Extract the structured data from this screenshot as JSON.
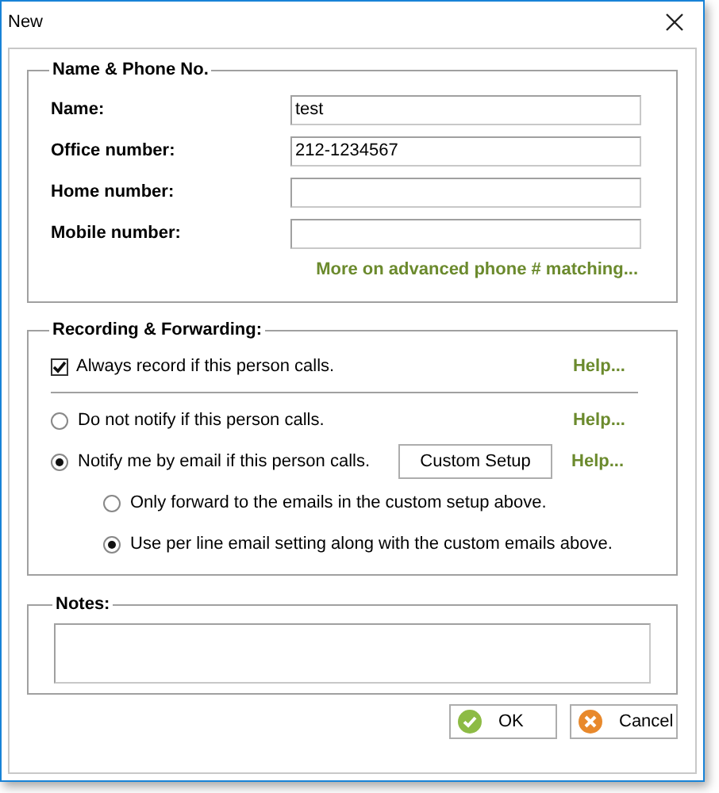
{
  "window": {
    "title": "New"
  },
  "name_phone": {
    "legend": "Name & Phone No.",
    "fields": [
      {
        "label": "Name:",
        "value": "test"
      },
      {
        "label": "Office number:",
        "value": "212-1234567"
      },
      {
        "label": "Home number:"
      },
      {
        "label": "Mobile number:"
      }
    ],
    "link": "More on advanced phone # matching..."
  },
  "recording": {
    "legend": "Recording & Forwarding:",
    "options": [
      {
        "kind": "checkbox",
        "label": "Always record if this person calls.",
        "checked": true,
        "help": "Help..."
      },
      {
        "kind": "radio",
        "label": "Do not notify if this person calls.",
        "selected": false,
        "help": "Help..."
      },
      {
        "kind": "radio",
        "label": "Notify me by email if this person calls.",
        "selected": true,
        "button": "Custom Setup",
        "help": "Help..."
      }
    ],
    "sub_options": [
      {
        "label": "Only forward to the emails in the custom setup above.",
        "selected": false
      },
      {
        "label": "Use per line email setting along with the custom emails above.",
        "selected": true
      }
    ]
  },
  "notes": {
    "legend": "Notes:"
  },
  "buttons": [
    {
      "kind": "ok",
      "label": "OK"
    },
    {
      "kind": "cancel",
      "label": "Cancel"
    }
  ]
}
